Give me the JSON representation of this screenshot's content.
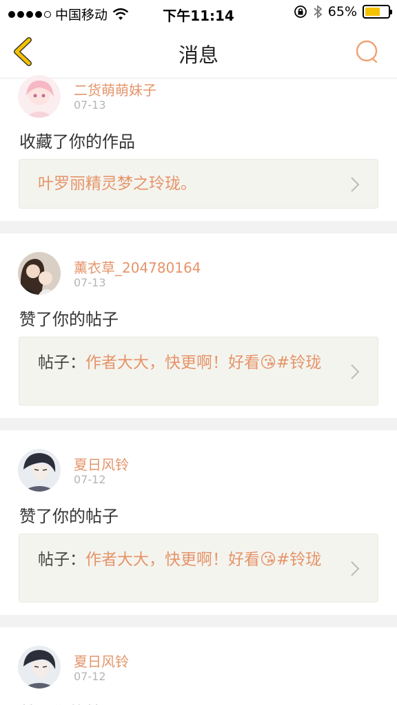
{
  "status_bar": {
    "carrier": "中国移动",
    "time": "下午11:14",
    "battery_percent": "65%",
    "battery_level": 0.65
  },
  "nav": {
    "title": "消息",
    "back_icon": "chevron-left-icon",
    "search_icon": "search-icon"
  },
  "colors": {
    "accent": "#e5946a",
    "back": "#f5c200",
    "ref_bg": "#f4f4ee"
  },
  "messages": [
    {
      "name": "二货萌萌妹子",
      "date": "07-13",
      "action": "收藏了你的作品",
      "ref_prefix": "",
      "ref_text": "叶罗丽精灵梦之玲珑。"
    },
    {
      "name": "薰衣草_204780164",
      "date": "07-13",
      "action": "赞了你的帖子",
      "ref_prefix": "帖子：",
      "ref_text": "作者大大，快更啊！好看😘#铃珑"
    },
    {
      "name": "夏日风铃",
      "date": "07-12",
      "action": "赞了你的帖子",
      "ref_prefix": "帖子：",
      "ref_text": "作者大大，快更啊！好看😘#铃珑"
    },
    {
      "name": "夏日风铃",
      "date": "07-12",
      "action": "赞了你的帖子"
    }
  ]
}
